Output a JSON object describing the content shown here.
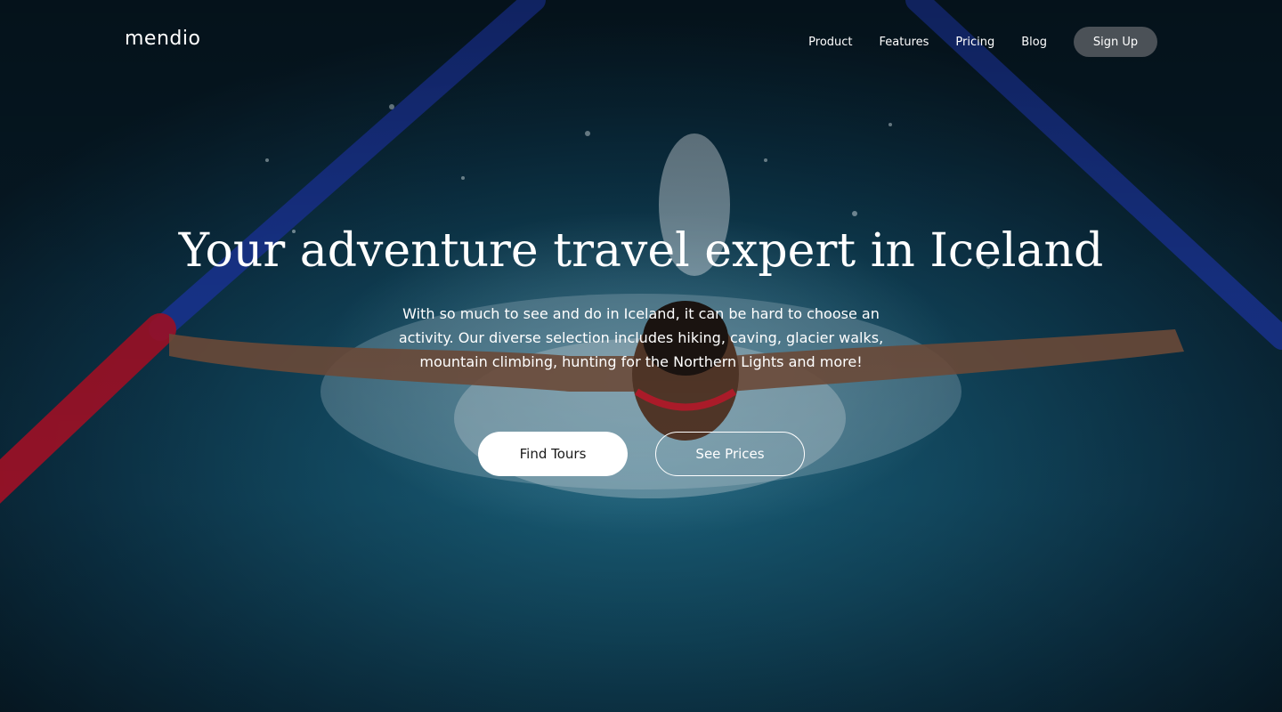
{
  "brand": {
    "logo_text": "mendio"
  },
  "nav": {
    "items": [
      {
        "label": "Product"
      },
      {
        "label": "Features"
      },
      {
        "label": "Pricing"
      },
      {
        "label": "Blog"
      }
    ],
    "signup_label": "Sign Up"
  },
  "hero": {
    "headline": "Your adventure travel expert in Iceland",
    "description": "With so much to see and do in Iceland, it can be hard to choose an activity. Our diverse selection includes hiking, caving, glacier walks, mountain climbing, hunting for the Northern Lights and more!",
    "primary_cta": "Find Tours",
    "secondary_cta": "See Prices",
    "background_image": "swimmer-butterfly-stroke-pool"
  },
  "colors": {
    "signup_bg": "#4b5157",
    "primary_cta_bg": "#ffffff",
    "water_blue": "#1d6a86"
  }
}
